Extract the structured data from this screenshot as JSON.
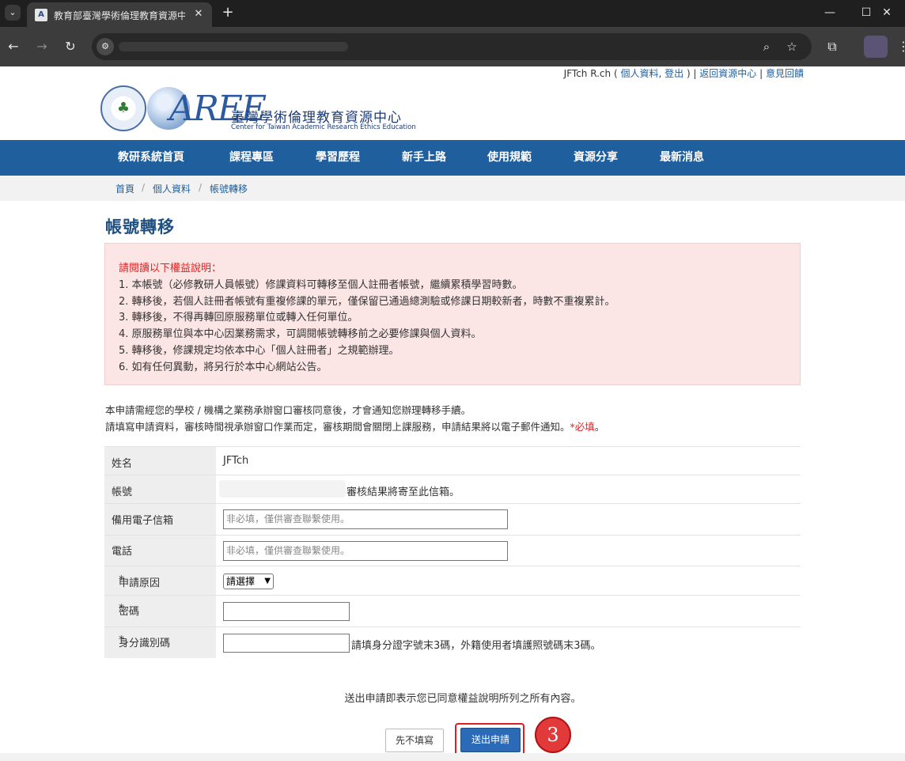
{
  "browser": {
    "tab_title": "教育部臺灣學術倫理教育資源中",
    "tab_favicon": "A",
    "new_tab": "+",
    "close_tab": "✕",
    "minimize": "—",
    "maximize": "☐",
    "close_window": "✕",
    "back": "←",
    "forward": "→",
    "reload": "↻",
    "site_info": "⚙",
    "zoom": "⌕",
    "bookmark": "☆",
    "extensions": "⧉",
    "menu": "⋮",
    "tab_list": "⌄"
  },
  "user_links": {
    "name": "JFTch R.ch",
    "open_paren": " ( ",
    "profile": "個人資料",
    "comma": ", ",
    "logout": "登出",
    "close_paren": " ) | ",
    "back_to_center": "返回資源中心",
    "pipe": " | ",
    "feedback": "意見回饋"
  },
  "logo": {
    "seal_glyph": "♣",
    "brand": "AREE",
    "name_cn": "臺灣學術倫理教育資源中心",
    "name_en": "Center for Taiwan Academic Research Ethics Education"
  },
  "nav": {
    "items": [
      "教研系統首頁",
      "課程專區",
      "學習歷程",
      "新手上路",
      "使用規範",
      "資源分享",
      "最新消息"
    ]
  },
  "breadcrumb": {
    "items": [
      "首頁",
      "個人資料",
      "帳號轉移"
    ],
    "sep": "/"
  },
  "page_title": "帳號轉移",
  "notice": {
    "heading": "請閱讀以下權益說明：",
    "lines": [
      "1. 本帳號（必修教研人員帳號）修課資料可轉移至個人註冊者帳號，繼續累積學習時數。",
      "2. 轉移後，若個人註冊者帳號有重複修課的單元，僅保留已通過總測驗或修課日期較新者，時數不重複累計。",
      "3. 轉移後，不得再轉回原服務單位或轉入任何單位。",
      "4. 原服務單位與本中心因業務需求，可調閱帳號轉移前之必要修課與個人資料。",
      "5. 轉移後，修課規定均依本中心「個人註冊者」之規範辦理。",
      "6. 如有任何異動，將另行於本中心網站公告。"
    ]
  },
  "description": {
    "line1": "本申請需經您的學校 / 機構之業務承辦窗口審核同意後，才會通知您辦理轉移手續。",
    "line2": "請填寫申請資料，審核時間視承辦窗口作業而定，審核期間會關閉上課服務，申請結果將以電子郵件通知。",
    "required_mark": "*必填",
    "period": "。"
  },
  "form": {
    "required_star": "*",
    "name_label": "姓名",
    "name_value": "JFTch",
    "account_label": "帳號",
    "account_note": "審核結果將寄至此信箱。",
    "backup_email_label": "備用電子信箱",
    "backup_email_placeholder": "非必填，僅供審查聯繫使用。",
    "phone_label": "電話",
    "phone_placeholder": "非必填，僅供審查聯繫使用。",
    "reason_label": "申請原因",
    "reason_selected": "請選擇",
    "password_label": "密碼",
    "id_label": "身分識別碼",
    "id_hint": "請填身分證字號末3碼，外籍使用者填護照號碼末3碼。"
  },
  "footer": {
    "agree_text": "送出申請即表示您已同意權益說明所列之所有內容。",
    "skip_button": "先不填寫",
    "submit_button": "送出申請",
    "step_number": "3"
  },
  "colors": {
    "nav_bg": "#1f5f9e",
    "notice_bg": "#fbe5e5",
    "required": "#dd2222",
    "highlight": "#e02020"
  }
}
